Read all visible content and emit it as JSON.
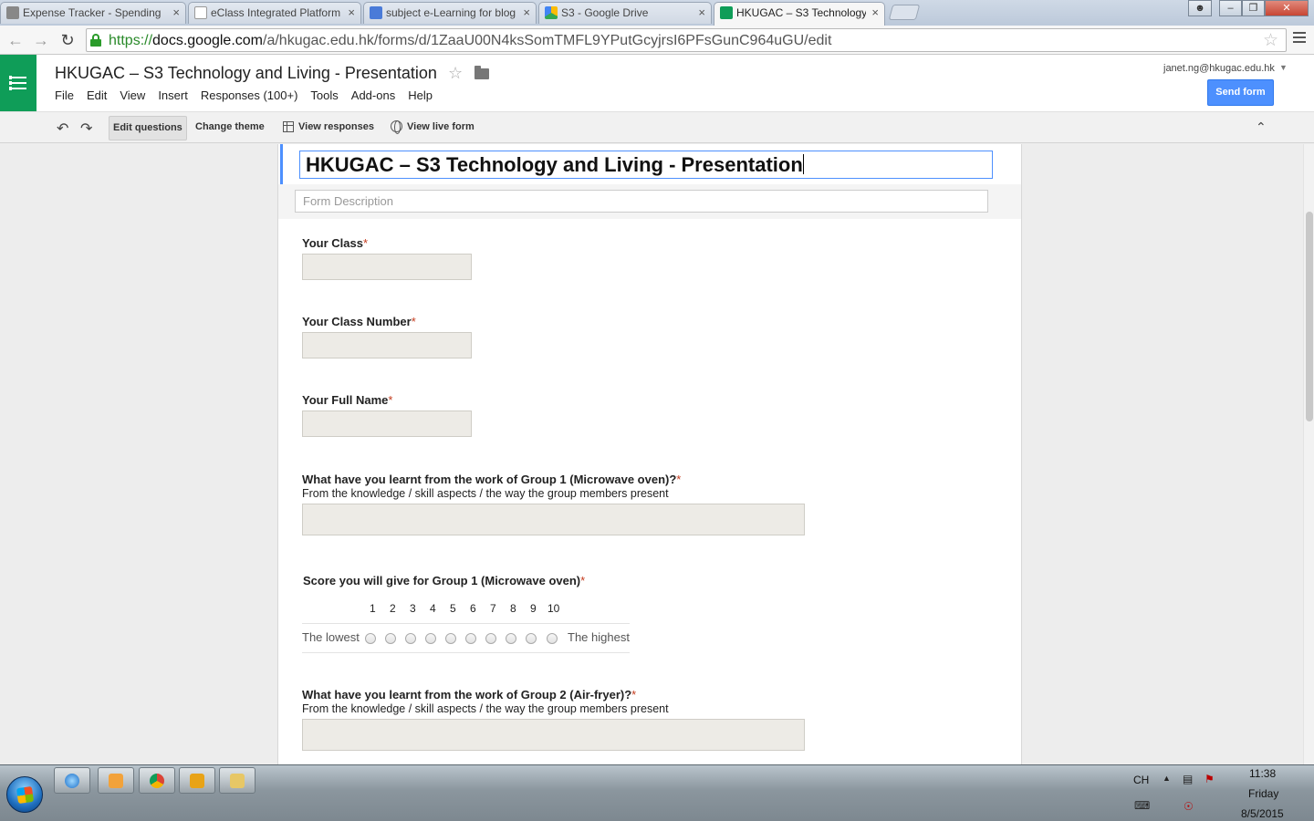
{
  "browser": {
    "tabs": [
      {
        "title": "Expense Tracker - Spending",
        "active": false
      },
      {
        "title": "eClass Integrated Platform",
        "active": false
      },
      {
        "title": "subject e-Learning for blog",
        "active": false
      },
      {
        "title": "S3 - Google Drive",
        "active": false
      },
      {
        "title": "HKUGAC – S3 Technology",
        "active": true
      }
    ],
    "tab_close_glyph": "×",
    "url_scheme": "https://",
    "url_host": "docs.google.com",
    "url_path": "/a/hkugac.edu.hk/forms/d/1ZaaU00N4ksSomTMFL9YPutGcyjrsI6PFsGunC964uGU/edit"
  },
  "docs": {
    "doc_title": "HKUGAC – S3 Technology and Living - Presentation",
    "menu": [
      "File",
      "Edit",
      "View",
      "Insert",
      "Responses (100+)",
      "Tools",
      "Add-ons",
      "Help"
    ],
    "account": "janet.ng@hkugac.edu.hk",
    "send_button": "Send form",
    "toolbar": {
      "edit_questions": "Edit questions",
      "change_theme": "Change theme",
      "view_responses": "View responses",
      "view_live_form": "View live form"
    }
  },
  "form": {
    "title": "HKUGAC – S3 Technology and Living - Presentation",
    "description_placeholder": "Form Description",
    "required_mark": "*",
    "questions": [
      {
        "title": "Your Class",
        "help": ""
      },
      {
        "title": "Your Class Number",
        "help": ""
      },
      {
        "title": "Your Full Name",
        "help": ""
      },
      {
        "title": "What have you learnt from the work of Group 1 (Microwave oven)?",
        "help": "From the knowledge / skill aspects / the way the group members present"
      },
      {
        "title": "Score you will give for Group 1 (Microwave oven)",
        "help": ""
      },
      {
        "title": "What have you learnt from the work of Group 2 (Air-fryer)?",
        "help": "From the knowledge / skill aspects / the way the group members present"
      }
    ],
    "scale": {
      "numbers": [
        "1",
        "2",
        "3",
        "4",
        "5",
        "6",
        "7",
        "8",
        "9",
        "10"
      ],
      "low_label": "The lowest",
      "high_label": "The highest"
    }
  },
  "taskbar": {
    "lang": "CH",
    "time": "11:38",
    "day": "Friday",
    "date": "8/5/2015"
  },
  "colors": {
    "forms_green": "#0f9d58",
    "send_blue": "#4d90fe",
    "required_red": "#c43b1d"
  }
}
